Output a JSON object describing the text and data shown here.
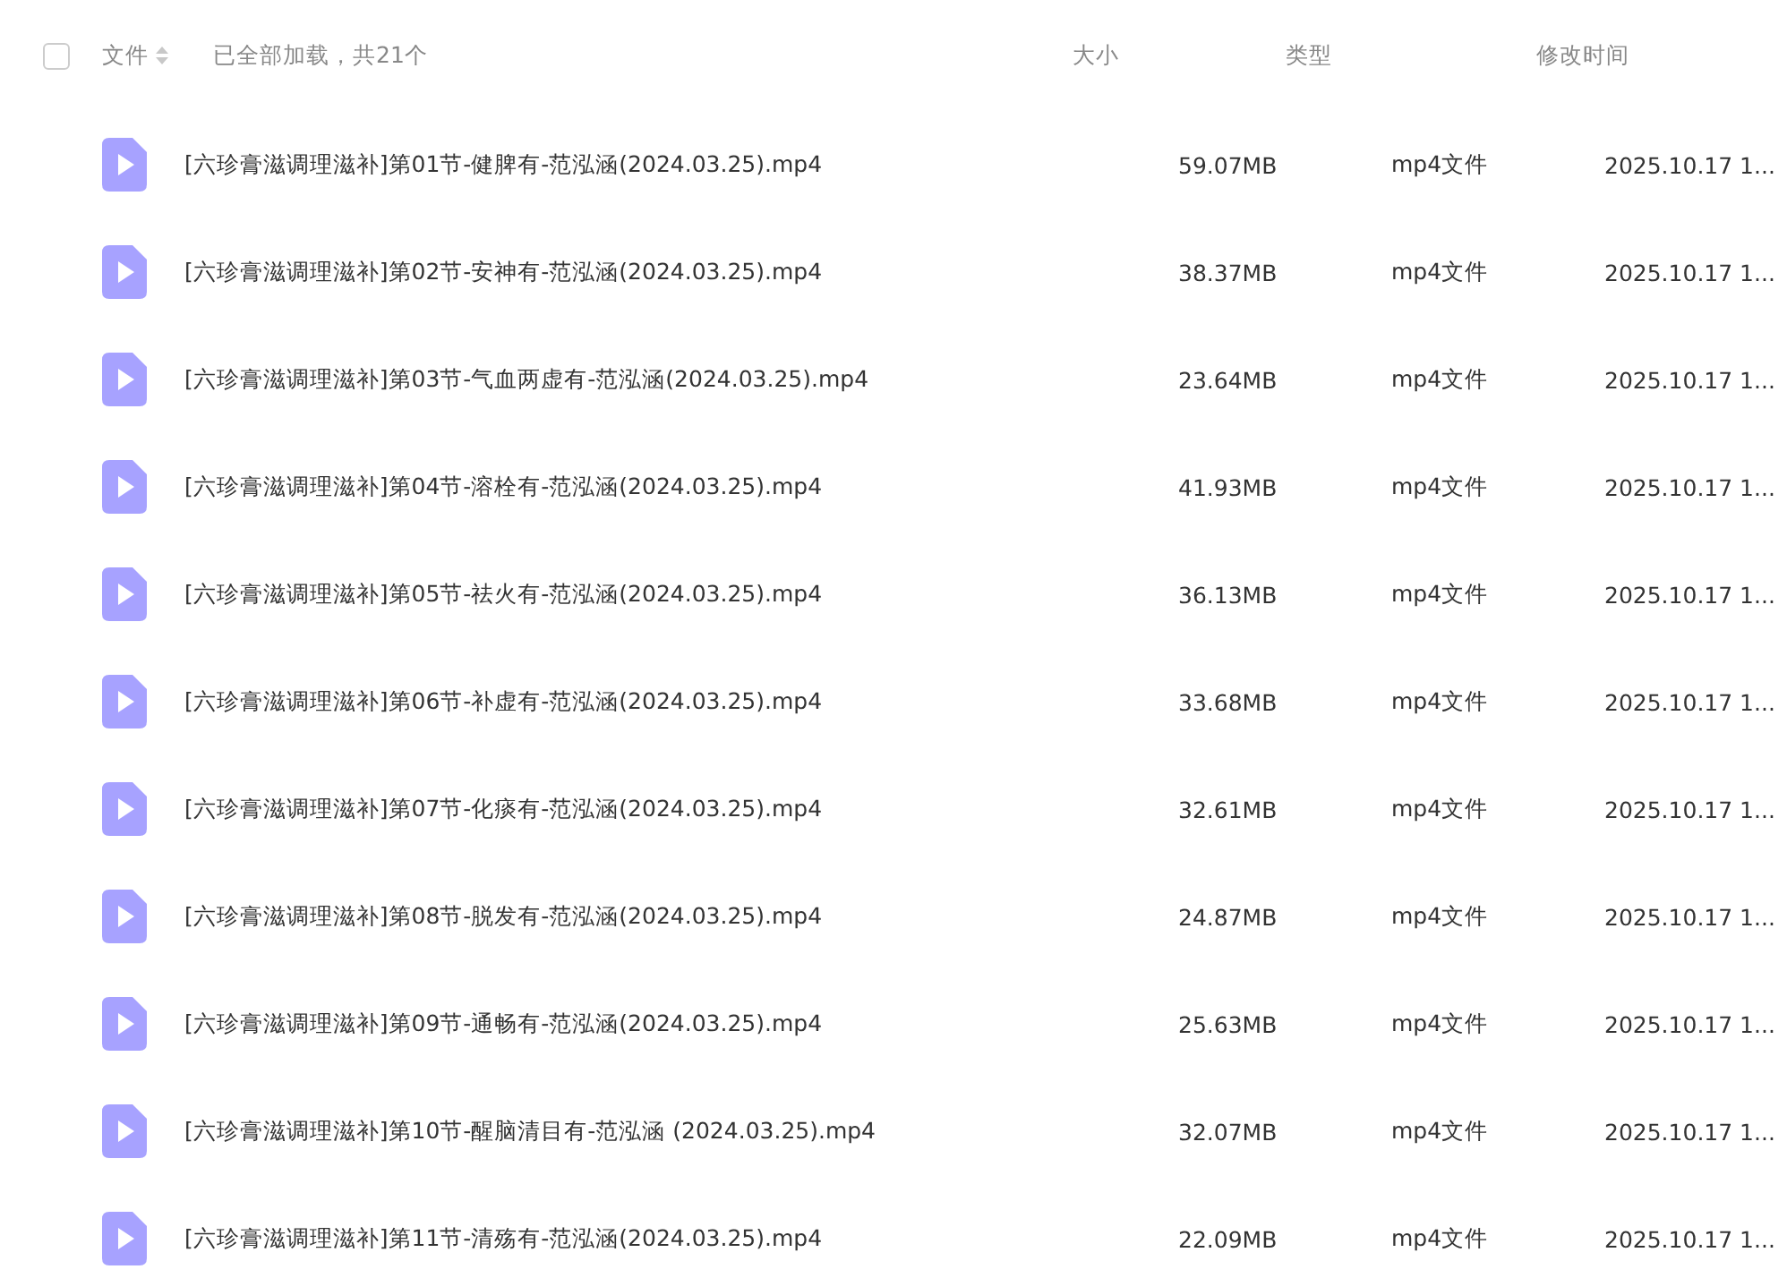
{
  "header": {
    "select_all": {
      "checked": false
    },
    "columns": [
      "文件",
      "大小",
      "类型",
      "修改时间"
    ],
    "status": "已全部加载，共21个"
  },
  "rows": [
    {
      "name": "[六珍膏滋调理滋补]第01节-健脾有-范泓涵(2024.03.25).mp4",
      "size": "59.07MB",
      "type": "mp4文件",
      "modified": "2025.10.17 1..."
    },
    {
      "name": "[六珍膏滋调理滋补]第02节-安神有-范泓涵(2024.03.25).mp4",
      "size": "38.37MB",
      "type": "mp4文件",
      "modified": "2025.10.17 1..."
    },
    {
      "name": "[六珍膏滋调理滋补]第03节-气血两虚有-范泓涵(2024.03.25).mp4",
      "size": "23.64MB",
      "type": "mp4文件",
      "modified": "2025.10.17 1..."
    },
    {
      "name": "[六珍膏滋调理滋补]第04节-溶栓有-范泓涵(2024.03.25).mp4",
      "size": "41.93MB",
      "type": "mp4文件",
      "modified": "2025.10.17 1..."
    },
    {
      "name": "[六珍膏滋调理滋补]第05节-祛火有-范泓涵(2024.03.25).mp4",
      "size": "36.13MB",
      "type": "mp4文件",
      "modified": "2025.10.17 1..."
    },
    {
      "name": "[六珍膏滋调理滋补]第06节-补虚有-范泓涵(2024.03.25).mp4",
      "size": "33.68MB",
      "type": "mp4文件",
      "modified": "2025.10.17 1..."
    },
    {
      "name": "[六珍膏滋调理滋补]第07节-化痰有-范泓涵(2024.03.25).mp4",
      "size": "32.61MB",
      "type": "mp4文件",
      "modified": "2025.10.17 1..."
    },
    {
      "name": "[六珍膏滋调理滋补]第08节-脱发有-范泓涵(2024.03.25).mp4",
      "size": "24.87MB",
      "type": "mp4文件",
      "modified": "2025.10.17 1..."
    },
    {
      "name": "[六珍膏滋调理滋补]第09节-通畅有-范泓涵(2024.03.25).mp4",
      "size": "25.63MB",
      "type": "mp4文件",
      "modified": "2025.10.17 1..."
    },
    {
      "name": "[六珍膏滋调理滋补]第10节-醒脑清目有-范泓涵 (2024.03.25).mp4",
      "size": "32.07MB",
      "type": "mp4文件",
      "modified": "2025.10.17 1..."
    },
    {
      "name": "[六珍膏滋调理滋补]第11节-清殇有-范泓涵(2024.03.25).mp4",
      "size": "22.09MB",
      "type": "mp4文件",
      "modified": "2025.10.17 1..."
    }
  ]
}
